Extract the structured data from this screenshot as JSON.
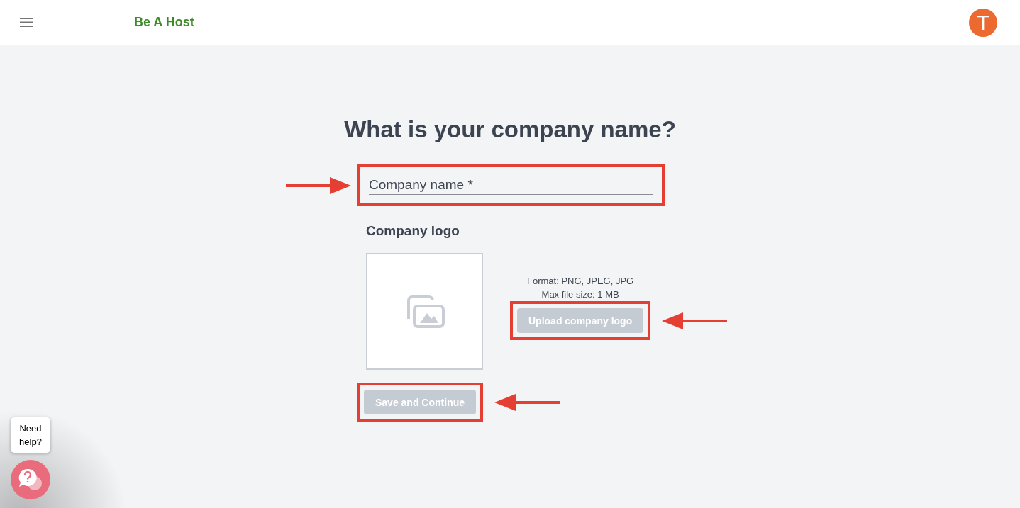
{
  "header": {
    "brand": "Be A Host",
    "avatar_letter": "T"
  },
  "title": "What is your company name?",
  "company_name_field": {
    "placeholder": "Company name *",
    "highlighted": true
  },
  "logo_section": {
    "label": "Company logo",
    "format_note": "Format: PNG, JPEG, JPG",
    "size_note": "Max file size: 1 MB",
    "upload_button": {
      "label": "Upload company logo",
      "disabled": true,
      "highlighted": true
    }
  },
  "save_button": {
    "label": "Save and Continue",
    "disabled": true,
    "highlighted": true
  },
  "help": {
    "tooltip": "Need help?"
  }
}
